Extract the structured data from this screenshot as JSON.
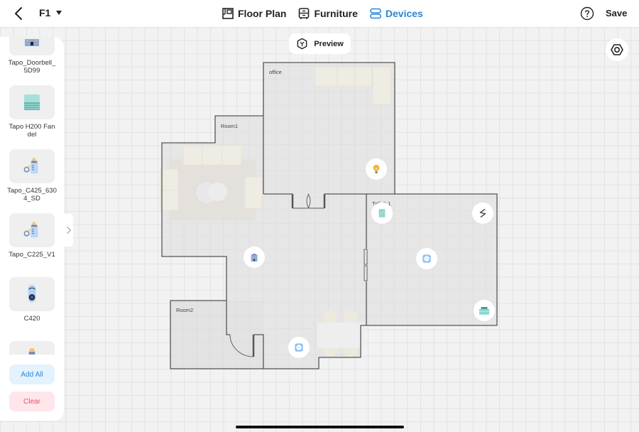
{
  "header": {
    "back_icon": "chevron-left-icon",
    "floor": "F1",
    "tabs": [
      {
        "label": "Floor Plan",
        "icon": "floor-plan-icon",
        "active": false
      },
      {
        "label": "Furniture",
        "icon": "furniture-icon",
        "active": false
      },
      {
        "label": "Devices",
        "icon": "devices-icon",
        "active": true
      }
    ],
    "help_icon": "help-icon",
    "save_label": "Save"
  },
  "colors": {
    "accent": "#2a86d8",
    "danger": "#ef4e6a",
    "wall": "#555555",
    "room_fill": "#e6e6e6"
  },
  "sidebar": {
    "devices": [
      {
        "name": "Tapo_Doorbell_5D99",
        "icon": "doorbell-icon"
      },
      {
        "name": "Tapo H200 Fandel",
        "icon": "hub-icon"
      },
      {
        "name": "Tapo_C425_6304_SD",
        "icon": "baby-bottle-icon"
      },
      {
        "name": "Tapo_C225_V1",
        "icon": "baby-bottle-icon"
      },
      {
        "name": "C420",
        "icon": "camera-icon"
      },
      {
        "name": "",
        "icon": "baby-bottle-icon"
      }
    ],
    "add_all_label": "Add All",
    "clear_label": "Clear"
  },
  "canvas": {
    "preview_label": "Preview",
    "rooms": [
      {
        "label": "office"
      },
      {
        "label": "Room1"
      },
      {
        "label": "Tplink 1"
      },
      {
        "label": "Room2"
      }
    ],
    "placed_devices": [
      {
        "name": "light-bulb",
        "icon": "light-bulb-icon"
      },
      {
        "name": "hub",
        "icon": "hub-icon"
      },
      {
        "name": "switch",
        "icon": "switch-icon"
      },
      {
        "name": "plug",
        "icon": "plug-icon"
      },
      {
        "name": "ir-remote",
        "icon": "device-box-icon"
      },
      {
        "name": "doorbell",
        "icon": "doorbell-icon"
      },
      {
        "name": "plug-2",
        "icon": "plug-icon"
      }
    ]
  }
}
